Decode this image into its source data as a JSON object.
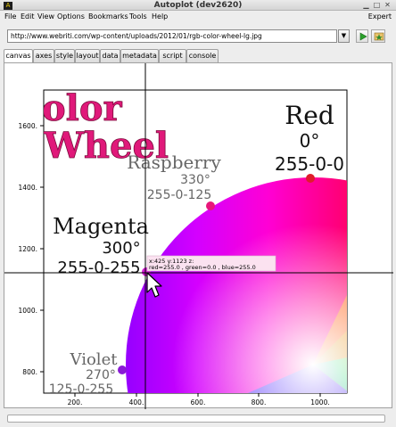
{
  "window": {
    "title": "Autoplot (dev2620)",
    "app_icon_glyph": "A"
  },
  "menu": {
    "items": [
      "File",
      "Edit",
      "View",
      "Options",
      "Bookmarks",
      "Tools",
      "Help"
    ],
    "right": "Expert"
  },
  "toolbar": {
    "url_value": "http://www.webriti.com/wp-content/uploads/2012/01/rgb-color-wheel-lg.jpg",
    "dropdown_icon": "chevron-down-icon",
    "play_icon": "play-icon",
    "bookmark_icon": "bookmark-icon"
  },
  "tabs": [
    "canvas",
    "axes",
    "style",
    "layout",
    "data",
    "metadata",
    "script",
    "console"
  ],
  "active_tab": "canvas",
  "plot": {
    "y_ticks": [
      "1600.",
      "1400.",
      "1200.",
      "1000.",
      "800."
    ],
    "x_ticks": [
      "200.",
      "400.",
      "600.",
      "800.",
      "1000."
    ],
    "image_text": {
      "heading_line1": "olor",
      "heading_line2": "Wheel",
      "red_name": "Red",
      "red_deg": "0°",
      "red_rgb": "255-0-0",
      "raspberry_name": "Raspberry",
      "raspberry_deg": "330°",
      "raspberry_rgb": "255-0-125",
      "magenta_name": "Magenta",
      "magenta_deg": "300°",
      "magenta_rgb": "255-0-255",
      "violet_name": "Violet",
      "violet_deg": "270°",
      "violet_rgb": "125-0-255"
    },
    "tooltip": {
      "line1": "x:425  y:1123  z:",
      "line2": "red=255.0 , green=0.0 , blue=255.0"
    },
    "colors": {
      "heading": "#e0197a",
      "red_dot": "#e01c2a",
      "raspberry_dot": "#e8177a",
      "magenta_dot": "#d51ad5",
      "violet_dot": "#8a1ad5"
    }
  }
}
